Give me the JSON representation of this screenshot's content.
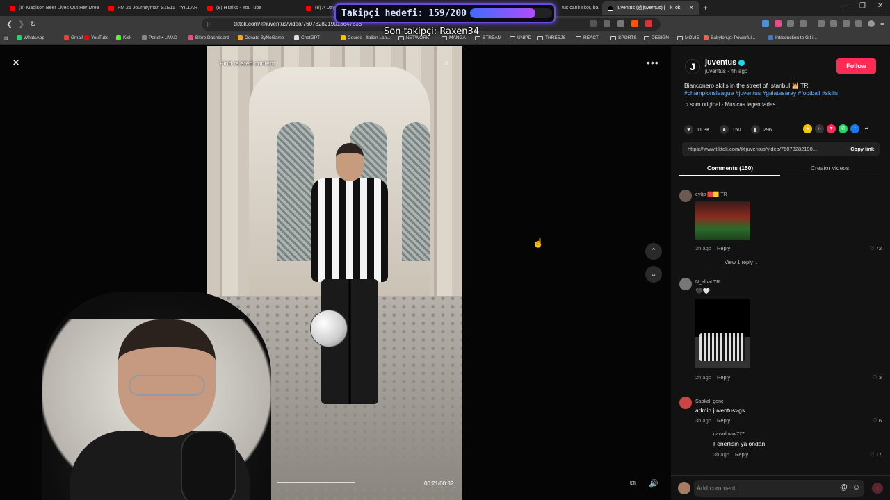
{
  "browser": {
    "tabs": [
      {
        "label": "(8) Madison Beer Lives Out Her Drea",
        "color": "#ff0000"
      },
      {
        "label": "FM 26 Journeyman S1E11 | \"YILLAR",
        "color": "#ff0000"
      },
      {
        "label": "(8) HTalks - YouTube",
        "color": "#ff0000"
      },
      {
        "label": "(8) A Day",
        "color": "#ff0000"
      },
      {
        "label": "tus canlı skor, ba",
        "color": "#888888"
      },
      {
        "label": "juventus (@juventus) | TikTok",
        "color": "#ffffff"
      }
    ],
    "url": "tiktok.com/@juventus/video/7607828219013647638",
    "bookmarks": [
      {
        "label": "WhatsApp",
        "type": "icon",
        "color": "#25d366"
      },
      {
        "label": "Gmail",
        "type": "icon",
        "color": "#ea4335"
      },
      {
        "label": "YouTube",
        "type": "icon",
        "color": "#ff0000"
      },
      {
        "label": "Kick",
        "type": "icon",
        "color": "#53fc18"
      },
      {
        "label": "Panel • LIVAD",
        "type": "icon",
        "color": "#888888"
      },
      {
        "label": "Blerp Dashboard",
        "type": "icon",
        "color": "#ff4081"
      },
      {
        "label": "Donate ByNoGame",
        "type": "icon",
        "color": "#f5a623"
      },
      {
        "label": "ChatGPT",
        "type": "icon",
        "color": "#dddddd"
      },
      {
        "label": "Course | Italian Lan...",
        "type": "icon",
        "color": "#f5c400"
      },
      {
        "label": "NETWORK",
        "type": "folder"
      },
      {
        "label": "MANGA",
        "type": "folder"
      },
      {
        "label": "STREAM",
        "type": "folder"
      },
      {
        "label": "UNIPD",
        "type": "folder"
      },
      {
        "label": "THREEJS",
        "type": "folder"
      },
      {
        "label": "REACT",
        "type": "folder"
      },
      {
        "label": "SPORTS",
        "type": "folder"
      },
      {
        "label": "DESIGN",
        "type": "folder"
      },
      {
        "label": "MOVIE",
        "type": "folder"
      },
      {
        "label": "Babylon.js: Powerful...",
        "type": "icon",
        "color": "#e0684b"
      },
      {
        "label": "Introduction to Git i...",
        "type": "icon",
        "color": "#3b7bd8"
      }
    ]
  },
  "overlay": {
    "goal_text": "Takipçi hedefi: 159/200",
    "goal_progress": 0.795,
    "last_follower": "Son takipçi: Raxen34"
  },
  "video": {
    "search_placeholder": "Find related content",
    "timecode": "00:21/00:32",
    "progress": 0.656
  },
  "post": {
    "author": "juventus",
    "author_sub": "juventus · 4h ago",
    "follow_label": "Follow",
    "caption": "Bianconero skills in the street of Istanbul 🕌 TR",
    "hashtags": "#championsleague #juventus #galatasaray #football #skills",
    "music": "som original - Músicas legendadas",
    "likes": "11.3K",
    "comments": "150",
    "saves": "296",
    "link": "https://www.tiktok.com/@juventus/video/76078282190...",
    "copy_label": "Copy link",
    "tab_comments": "Comments (150)",
    "tab_creator": "Creator videos"
  },
  "comments": [
    {
      "user": "eyüp 🟥🟨 TR",
      "text": "",
      "time": "3h ago",
      "reply": "Reply",
      "likes": "72",
      "view_replies": "View 1 reply"
    },
    {
      "user": "N_albat TR",
      "text": "🖤🤍",
      "time": "2h ago",
      "reply": "Reply",
      "likes": "3"
    },
    {
      "user": "Şapkalı genç",
      "text": "admin juventus>gs",
      "time": "3h ago",
      "reply": "Reply",
      "likes": "6"
    },
    {
      "user": "cavadovvv777",
      "text": "Fenerlisin ya ondan",
      "time": "3h ago",
      "reply": "Reply",
      "likes": "17"
    }
  ],
  "add_comment_placeholder": "Add comment..."
}
